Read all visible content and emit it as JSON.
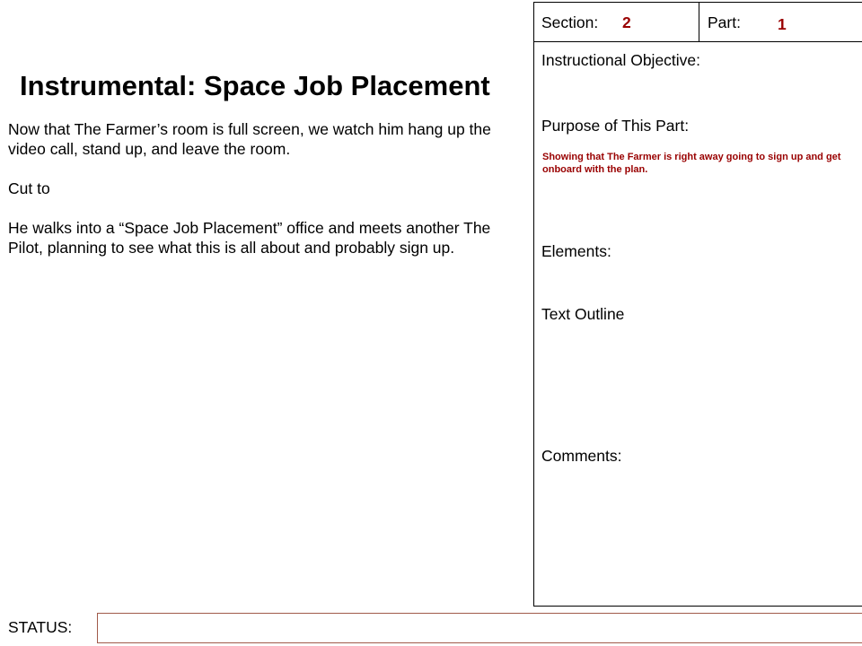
{
  "title": "Instrumental: Space Job Placement",
  "body": {
    "paragraphs": [
      "Now that The Farmer’s room is full screen, we watch him hang up the video call, stand up, and leave the room.",
      "Cut to",
      "He walks into a “Space Job Placement” office and meets another The Pilot, planning to see what this is all about and probably sign up."
    ]
  },
  "panel": {
    "section_label": "Section:",
    "section_value": "2",
    "part_label": "Part:",
    "part_value": "1",
    "objective_label": "Instructional Objective:",
    "purpose_label": "Purpose of This Part:",
    "purpose_text": "Showing that The Farmer is right away going to sign up and get onboard with the plan.",
    "elements_label": "Elements:",
    "outline_label": "Text Outline",
    "comments_label": "Comments:"
  },
  "status": {
    "label": "STATUS:",
    "value": ""
  },
  "colors": {
    "accent": "#990000",
    "status_border": "#a05a4a"
  }
}
